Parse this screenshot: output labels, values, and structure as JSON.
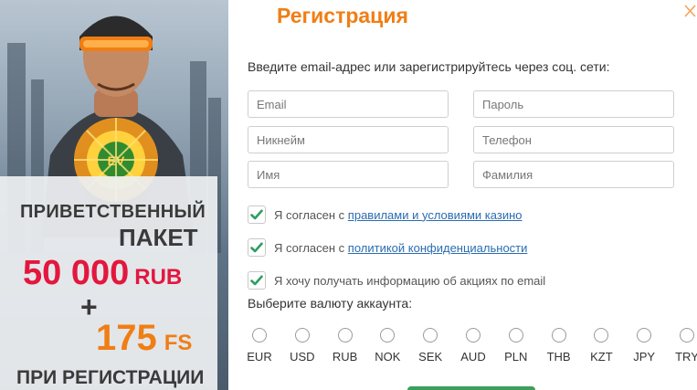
{
  "promo": {
    "line1": "ПРИВЕТСТВЕННЫЙ",
    "line2": "ПАКЕТ",
    "amount": "50 000",
    "amount_currency": "RUB",
    "plus": "+",
    "fs_amount": "175",
    "fs_label": "FS",
    "line3": "ПРИ РЕГИСТРАЦИИ",
    "colors": {
      "amount": "#e3173e",
      "fs": "#f07e15"
    }
  },
  "dialog": {
    "title": "Регистрация",
    "close_icon": "close-icon",
    "subtitle": "Введите email-адрес или зарегистрируйтесь через соц. сети:"
  },
  "fields": {
    "email": {
      "placeholder": "Email",
      "value": ""
    },
    "password": {
      "placeholder": "Пароль",
      "value": ""
    },
    "nickname": {
      "placeholder": "Никнейм",
      "value": ""
    },
    "phone": {
      "placeholder": "Телефон",
      "value": ""
    },
    "first_name": {
      "placeholder": "Имя",
      "value": ""
    },
    "last_name": {
      "placeholder": "Фамилия",
      "value": ""
    }
  },
  "checkboxes": {
    "terms": {
      "prefix": "Я согласен с ",
      "link": "правилами и условиями казино",
      "checked": true
    },
    "privacy": {
      "prefix": "Я согласен с ",
      "link": "политикой конфиденциальности",
      "checked": true
    },
    "promo_email": {
      "label": "Я хочу получать информацию об акциях по email",
      "checked": true
    }
  },
  "currency": {
    "label": "Выберите валюту аккаунта:",
    "options": [
      "EUR",
      "USD",
      "RUB",
      "NOK",
      "SEK",
      "AUD",
      "PLN",
      "THB",
      "KZT",
      "JPY",
      "TRY"
    ],
    "selected": null
  },
  "colors": {
    "accent": "#f07e15",
    "check": "#2f9e63",
    "link": "#2b6cb0"
  }
}
